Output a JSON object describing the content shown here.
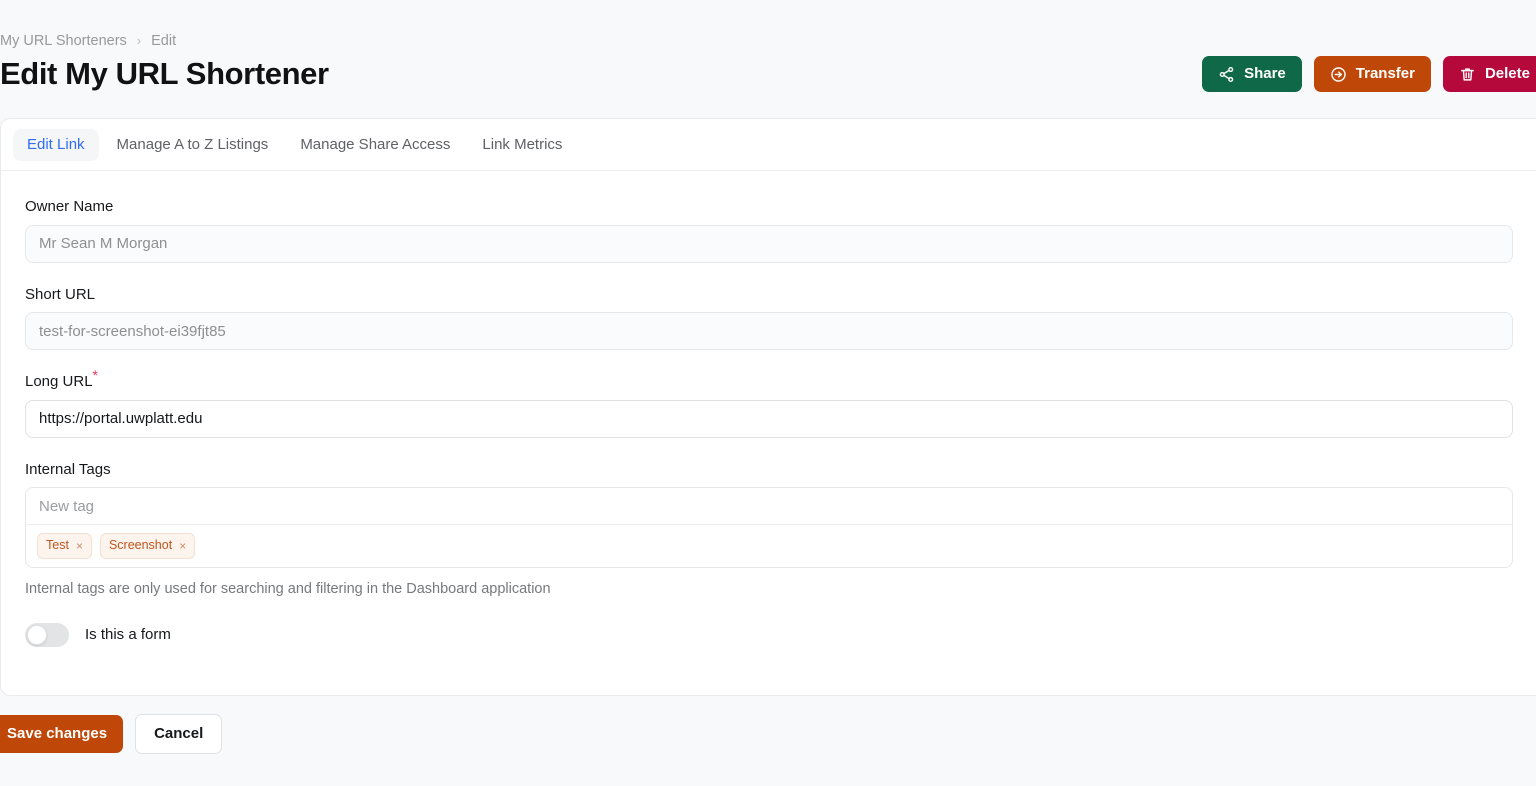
{
  "breadcrumb": {
    "items": [
      {
        "label": "My URL Shorteners",
        "icon": ""
      },
      {
        "label": "Edit",
        "icon": ""
      }
    ],
    "separator": "›"
  },
  "header": {
    "title": "Edit My URL Shortener",
    "actions": [
      {
        "label": "Share",
        "icon": "share-icon",
        "color": "#0f6848"
      },
      {
        "label": "Transfer",
        "icon": "transfer-icon",
        "color": "#bf4708"
      },
      {
        "label": "Delete",
        "icon": "trash-icon",
        "color": "#b5093b"
      }
    ]
  },
  "tabs": [
    {
      "label": "Edit Link",
      "active": true
    },
    {
      "label": "Manage A to Z Listings",
      "active": false
    },
    {
      "label": "Manage Share Access",
      "active": false
    },
    {
      "label": "Link Metrics",
      "active": false
    }
  ],
  "form": {
    "owner_name": {
      "label": "Owner Name",
      "value": "Mr Sean M Morgan",
      "readonly": true
    },
    "short_url": {
      "label": "Short URL",
      "value": "test-for-screenshot-ei39fjt85",
      "readonly": true
    },
    "long_url": {
      "label": "Long URL",
      "required_marker": "*",
      "value": "https://portal.uwplatt.edu",
      "readonly": false
    },
    "internal_tags": {
      "label": "Internal Tags",
      "placeholder": "New tag",
      "value": "",
      "tags": [
        {
          "label": "Test",
          "remove": "×"
        },
        {
          "label": "Screenshot",
          "remove": "×"
        }
      ],
      "help_text": "Internal tags are only used for searching and filtering in the Dashboard application"
    },
    "is_form_toggle": {
      "label": "Is this a form",
      "checked": false
    }
  },
  "footer": {
    "save_label": "Save changes",
    "cancel_label": "Cancel"
  },
  "colors": {
    "page_background": "#f8f9fa",
    "card_background": "#ffffff",
    "accent_blue": "#2f6ef0",
    "share_green": "#0f6848",
    "transfer_orange": "#bf4708",
    "delete_crimson": "#b5093b",
    "tag_text": "#c0551f",
    "required_red": "#e8355a"
  }
}
